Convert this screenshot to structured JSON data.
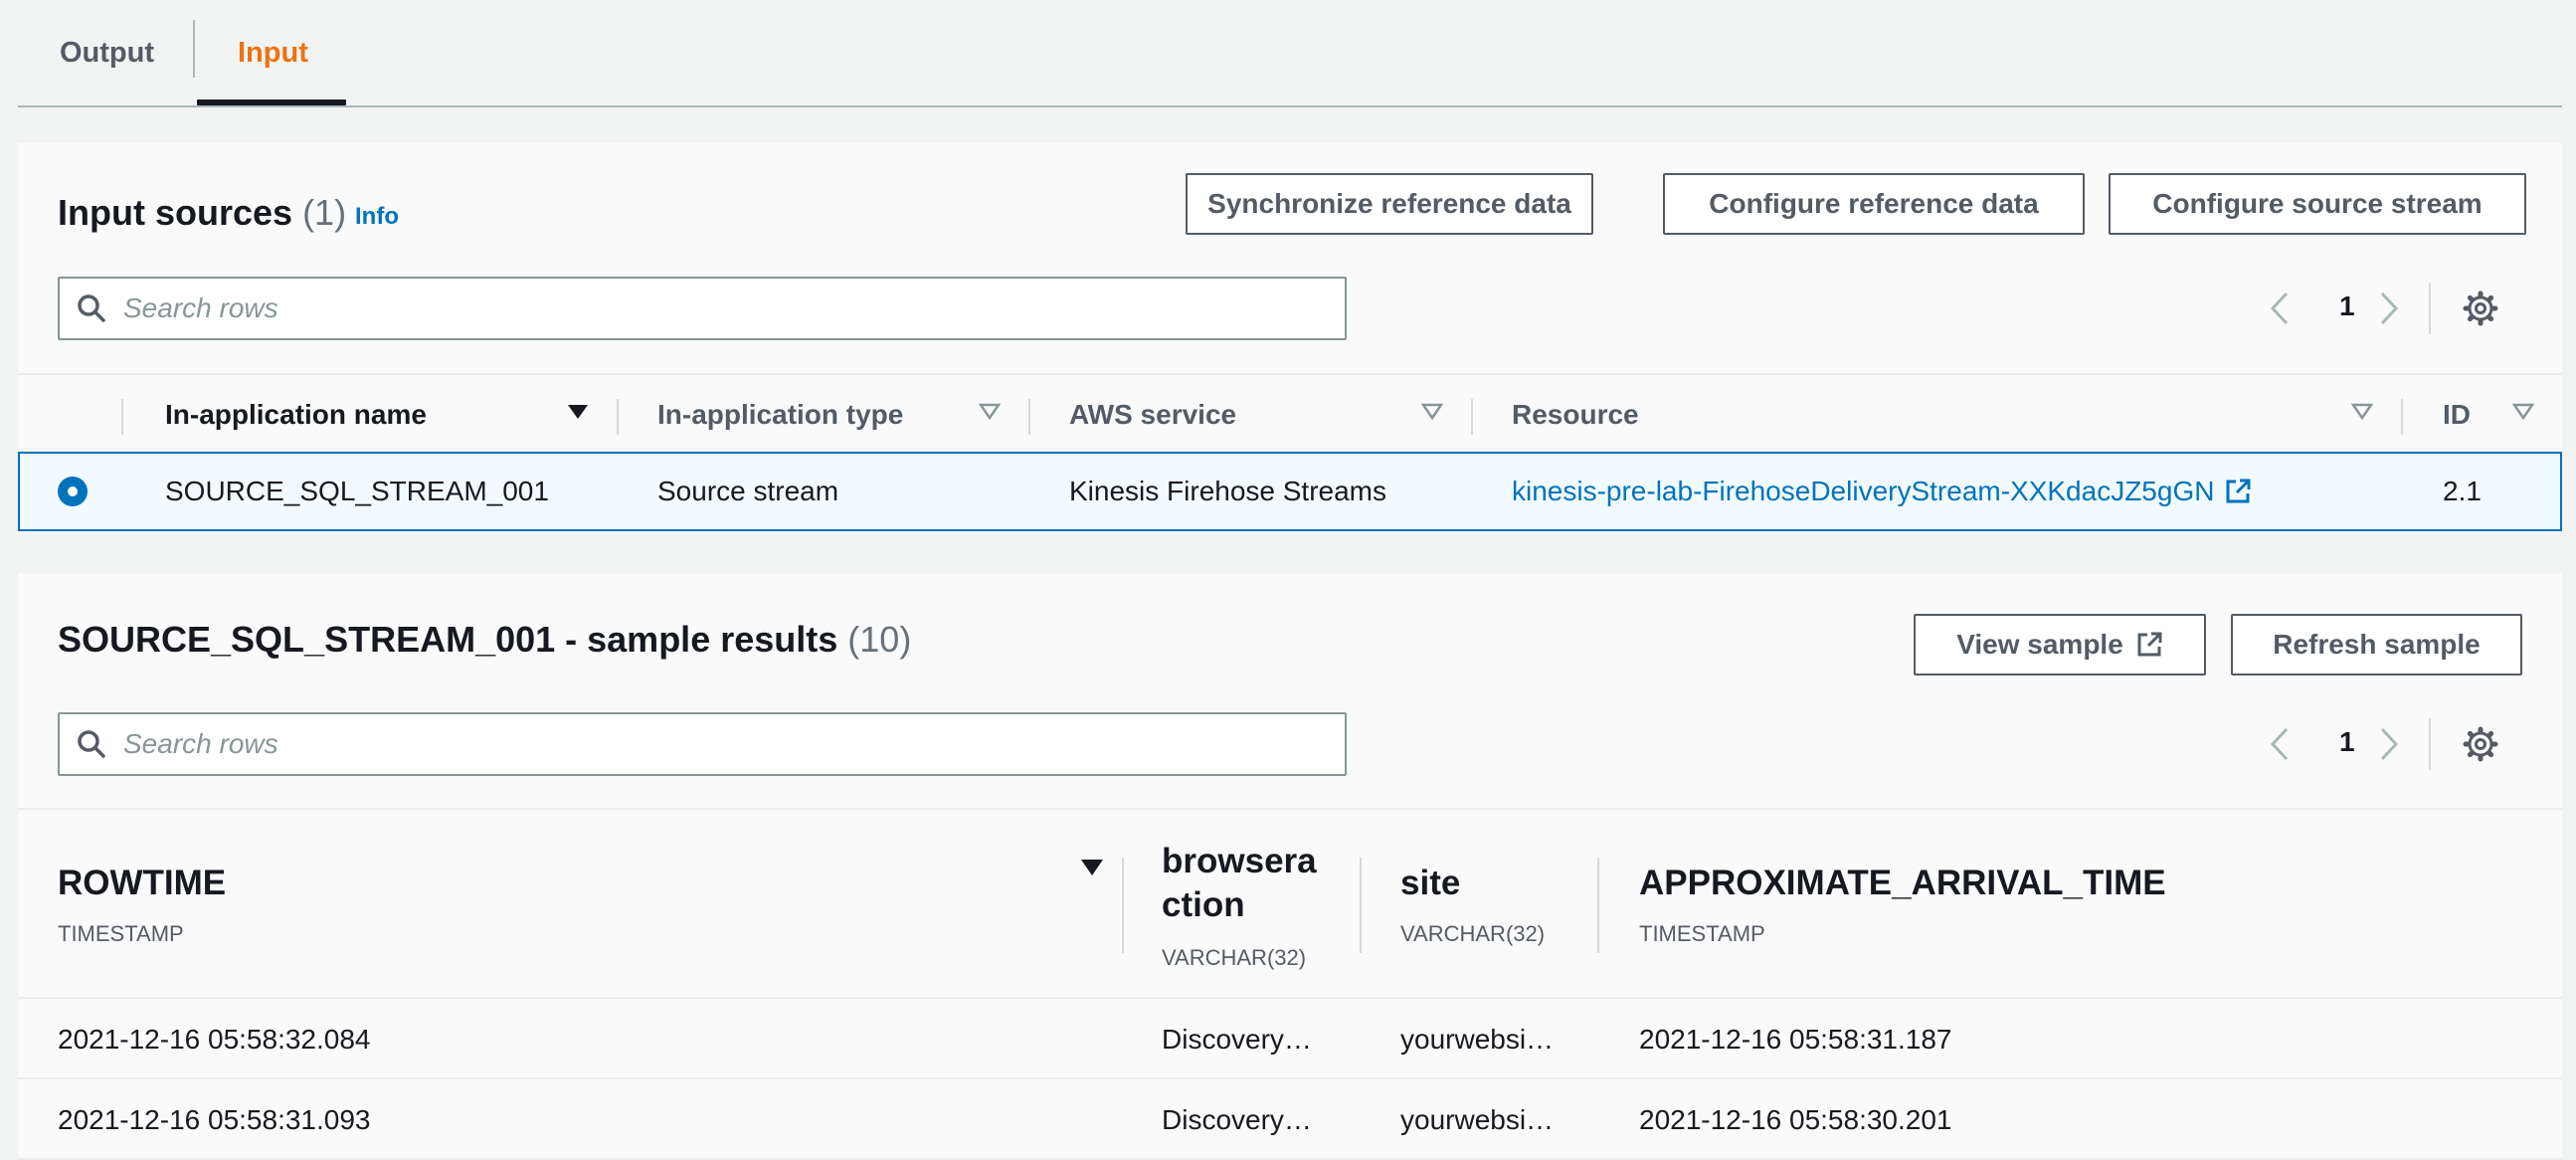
{
  "tabs": [
    {
      "label": "Output",
      "active": false
    },
    {
      "label": "Input",
      "active": true
    }
  ],
  "colors": {
    "accent": "#ec7211",
    "link": "#0073bb",
    "selected_row_bg": "#f1faff"
  },
  "input_sources": {
    "title": "Input sources",
    "count": "(1)",
    "info_label": "Info",
    "buttons": {
      "sync": "Synchronize reference data",
      "configure_ref": "Configure reference data",
      "configure_source": "Configure source stream"
    },
    "search_placeholder": "Search rows",
    "page": "1",
    "columns": [
      "In-application name",
      "In-application type",
      "AWS service",
      "Resource",
      "ID"
    ],
    "rows": [
      {
        "selected": true,
        "name": "SOURCE_SQL_STREAM_001",
        "type": "Source stream",
        "service": "Kinesis Firehose Streams",
        "resource": "kinesis-pre-lab-FirehoseDeliveryStream-XXKdacJZ5gGN",
        "id": "2.1"
      }
    ]
  },
  "sample_results": {
    "title": "SOURCE_SQL_STREAM_001 - sample results",
    "count": "(10)",
    "buttons": {
      "view": "View sample",
      "refresh": "Refresh sample"
    },
    "search_placeholder": "Search rows",
    "page": "1",
    "columns": [
      {
        "name": "ROWTIME",
        "type": "TIMESTAMP"
      },
      {
        "name_line1": "browsera",
        "name_line2": "ction",
        "type": "VARCHAR(32)"
      },
      {
        "name": "site",
        "type": "VARCHAR(32)"
      },
      {
        "name": "APPROXIMATE_ARRIVAL_TIME",
        "type": "TIMESTAMP"
      }
    ],
    "rows": [
      {
        "rowtime": "2021-12-16 05:58:32.084",
        "browseraction": "Discovery…",
        "site": "yourwebsi…",
        "arrival": "2021-12-16 05:58:31.187"
      },
      {
        "rowtime": "2021-12-16 05:58:31.093",
        "browseraction": "Discovery…",
        "site": "yourwebsi…",
        "arrival": "2021-12-16 05:58:30.201"
      }
    ]
  }
}
